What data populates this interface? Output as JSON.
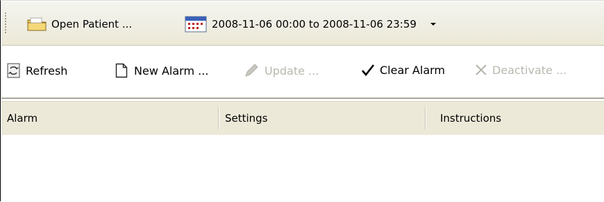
{
  "toolbar_top": {
    "open_patient_label": "Open Patient ...",
    "date_range_label": "2008-11-06 00:00 to 2008-11-06 23:59"
  },
  "toolbar_actions": {
    "refresh_label": "Refresh",
    "new_alarm_label": "New Alarm ...",
    "update_label": "Update ...",
    "clear_alarm_label": "Clear Alarm",
    "deactivate_label": "Deactivate ..."
  },
  "table": {
    "columns": [
      "Alarm",
      "Settings",
      "Instructions"
    ],
    "rows": []
  },
  "colors": {
    "toolbar_bg": "#ece9d8",
    "disabled_text": "#b8b8b0"
  }
}
